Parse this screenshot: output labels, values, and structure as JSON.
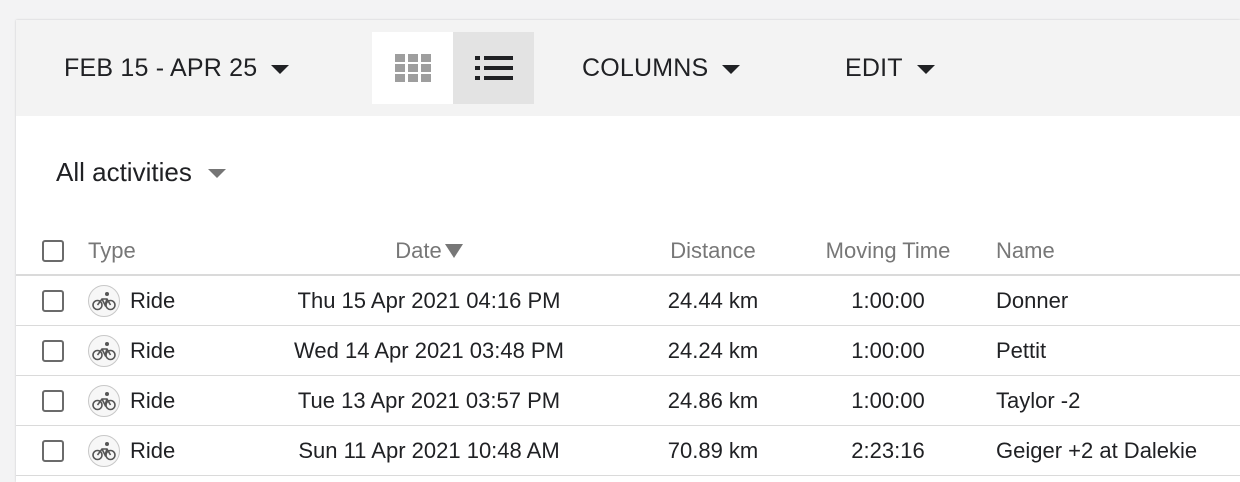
{
  "toolbar": {
    "date_range": "FEB 15 - APR 25",
    "columns_label": "COLUMNS",
    "edit_label": "EDIT"
  },
  "filter": {
    "label": "All activities"
  },
  "table": {
    "headers": {
      "type": "Type",
      "date": "Date",
      "distance": "Distance",
      "moving_time": "Moving Time",
      "name": "Name"
    },
    "rows": [
      {
        "type": "Ride",
        "date": "Thu 15 Apr 2021 04:16 PM",
        "distance": "24.44 km",
        "moving_time": "1:00:00",
        "name": "Donner"
      },
      {
        "type": "Ride",
        "date": "Wed 14 Apr 2021 03:48 PM",
        "distance": "24.24 km",
        "moving_time": "1:00:00",
        "name": "Pettit"
      },
      {
        "type": "Ride",
        "date": "Tue 13 Apr 2021 03:57 PM",
        "distance": "24.86 km",
        "moving_time": "1:00:00",
        "name": "Taylor -2"
      },
      {
        "type": "Ride",
        "date": "Sun 11 Apr 2021 10:48 AM",
        "distance": "70.89 km",
        "moving_time": "2:23:16",
        "name": "Geiger +2 at Dalekie"
      }
    ]
  },
  "icons": {
    "grid_view": "grid-icon",
    "list_view": "list-icon",
    "activity_type": "bicycle-icon",
    "dropdown": "caret-down-icon"
  },
  "colors": {
    "toolbar_bg": "#f3f3f3",
    "active_toggle_bg": "#e3e3e3",
    "header_text": "#777777",
    "body_text": "#202124"
  }
}
